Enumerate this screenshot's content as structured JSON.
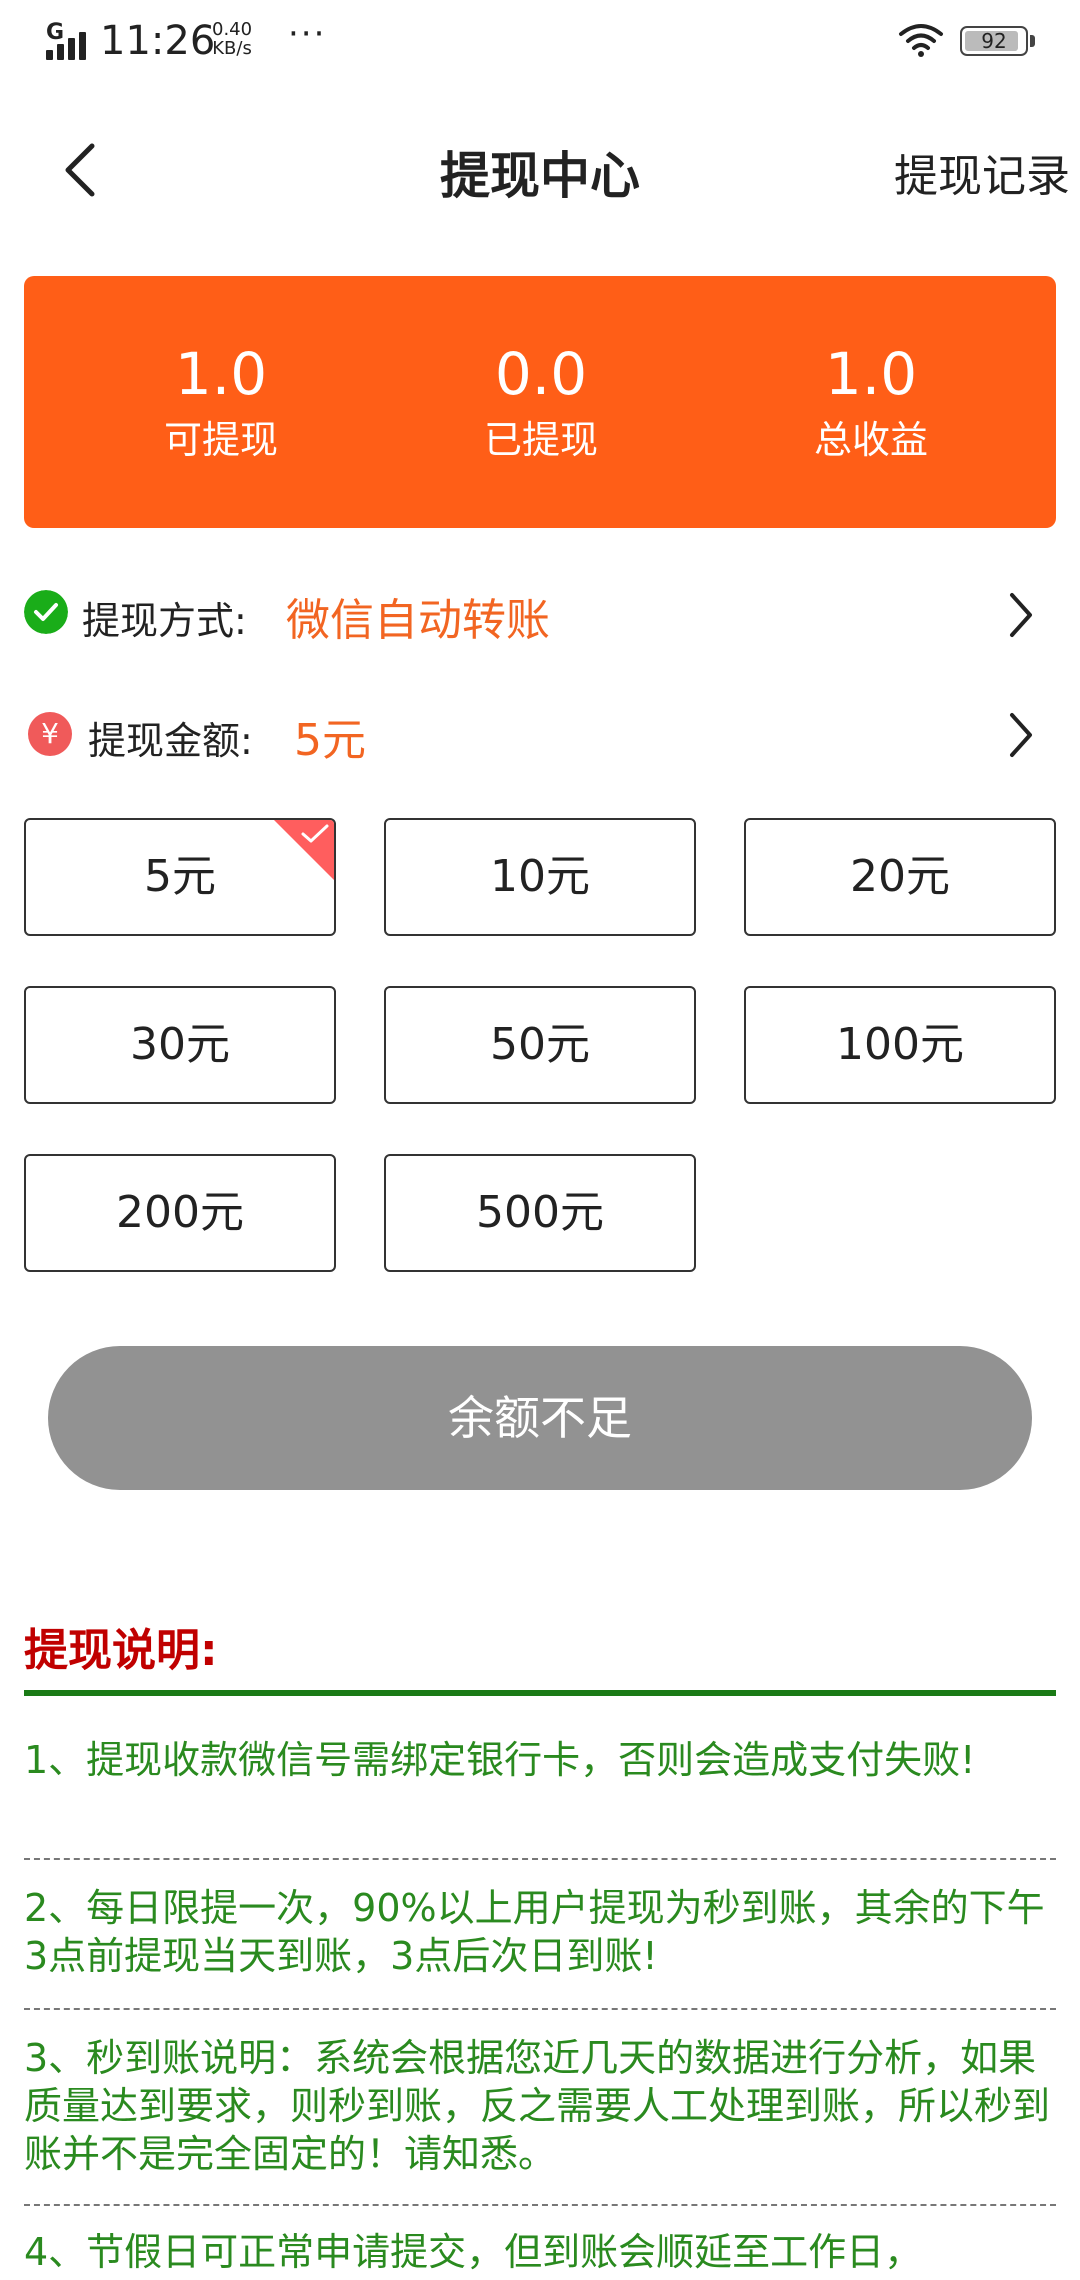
{
  "status_bar": {
    "network": "G",
    "time": "11:26",
    "speed_value": "0.40",
    "speed_unit": "KB/s",
    "more": "···",
    "battery": "92"
  },
  "header": {
    "title": "提现中心",
    "record_link": "提现记录"
  },
  "stats": [
    {
      "value": "1.0",
      "label": "可提现"
    },
    {
      "value": "0.0",
      "label": "已提现"
    },
    {
      "value": "1.0",
      "label": "总收益"
    }
  ],
  "method": {
    "label": "提现方式:",
    "value": "微信自动转账"
  },
  "amount": {
    "label": "提现金额:",
    "value": "5元",
    "icon_text": "¥"
  },
  "amount_options": [
    "5元",
    "10元",
    "20元",
    "30元",
    "50元",
    "100元",
    "200元",
    "500元"
  ],
  "selected_option_index": 0,
  "submit_label": "余额不足",
  "notes": {
    "title": "提现说明:",
    "items": [
      "1、提现收款微信号需绑定银行卡，否则会造成支付失败!",
      "2、每日限提一次，90%以上用户提现为秒到账，其余的下午3点前提现当天到账，3点后次日到账!",
      "3、秒到账说明：系统会根据您近几天的数据进行分析，如果质量达到要求，则秒到账，反之需要人工处理到账，所以秒到账并不是完全固定的！请知悉。",
      "4、节假日可正常申请提交，但到账会顺延至工作日，"
    ]
  },
  "colors": {
    "accent": "#ff5e17",
    "selected": "#f26522",
    "notes_title": "#c00000",
    "notes_text": "#2a8a1f",
    "button_disabled": "#929292"
  }
}
